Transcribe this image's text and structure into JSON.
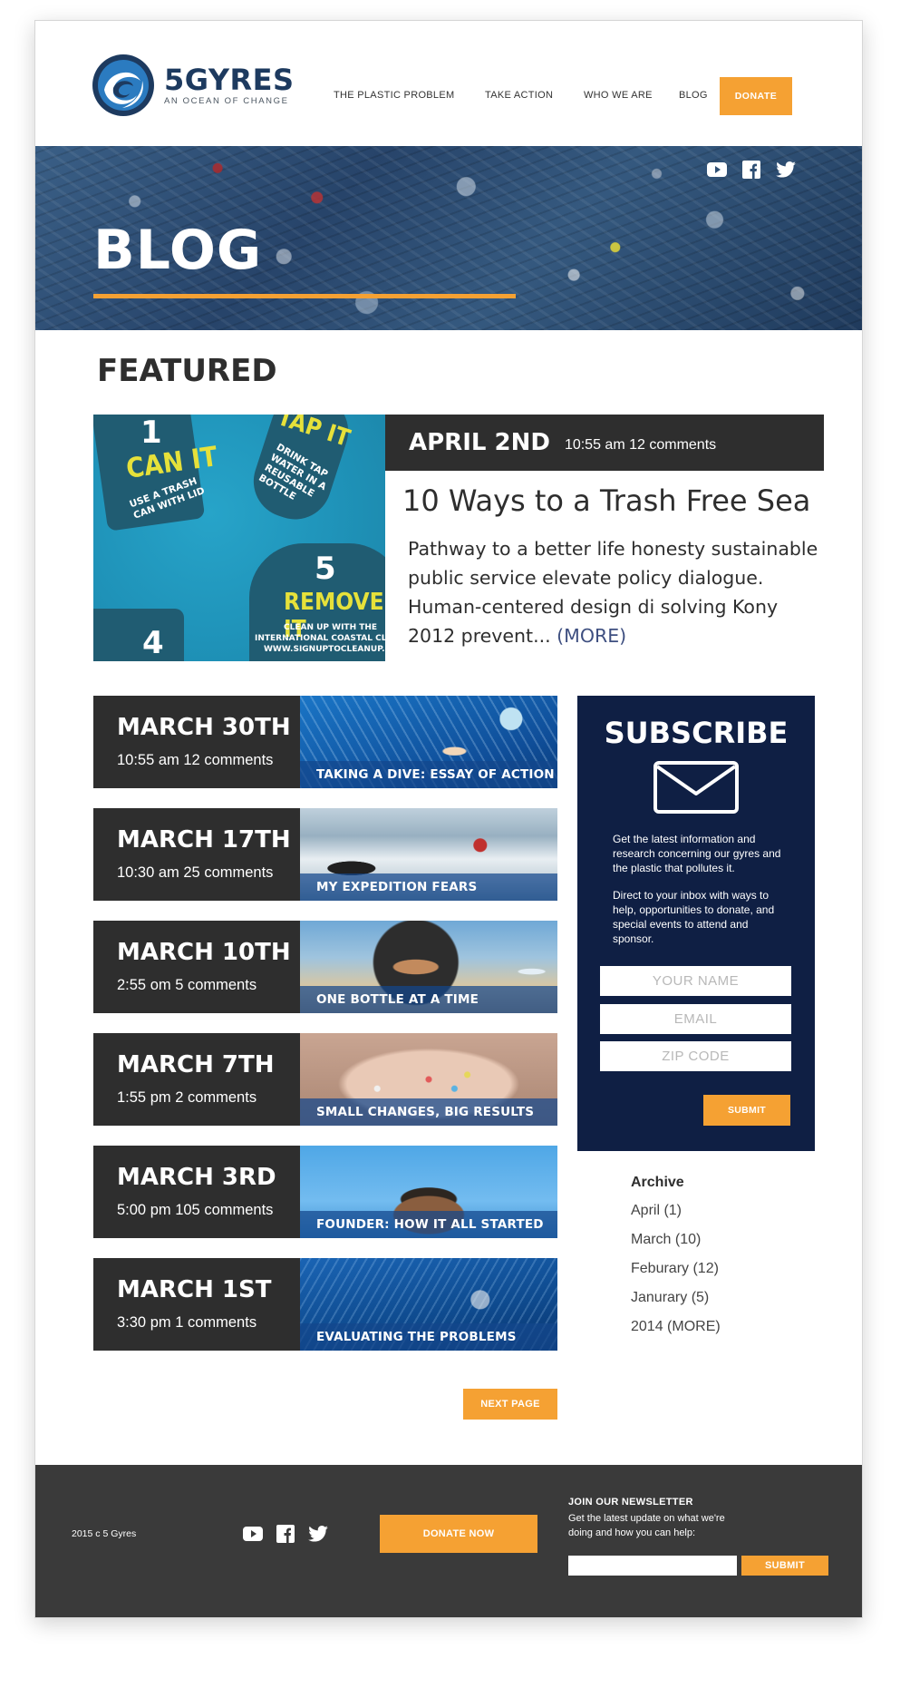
{
  "brand": {
    "name": "5GYRES",
    "tagline": "AN OCEAN OF CHANGE"
  },
  "nav": {
    "items": [
      {
        "label": "THE PLASTIC PROBLEM"
      },
      {
        "label": "TAKE ACTION"
      },
      {
        "label": "WHO WE ARE"
      },
      {
        "label": "BLOG"
      }
    ],
    "donate_label": "DONATE"
  },
  "hero": {
    "title": "BLOG",
    "social_icons": [
      "youtube-icon",
      "facebook-icon",
      "twitter-icon"
    ]
  },
  "featured": {
    "section_title": "FEATURED",
    "date": "APRIL 2ND",
    "meta": "10:55 am  12 comments",
    "title": "10 Ways to a Trash Free Sea",
    "excerpt": "Pathway to a better life honesty sustainable public service elevate policy dialogue. Human-centered design di solving Kony 2012 prevent...",
    "more_label": "(MORE)",
    "image_text": {
      "num1": "1",
      "can_it": "CAN IT",
      "can_it_sub": "USE A TRASH CAN WITH LID",
      "tap_it": "TAP IT",
      "tap_it_sub": "DRINK TAP WATER IN A REUSABLE BOTTLE",
      "num5": "5",
      "remove_it": "REMOVE IT",
      "remove_sub1": "CLEAN UP WITH THE",
      "remove_sub2": "INTERNATIONAL COASTAL CLEAN",
      "remove_sub3": "WWW.SIGNUPTOCLEANUP.ORG",
      "num4": "4"
    }
  },
  "posts": [
    {
      "date": "MARCH 30TH",
      "meta": "10:55 am  12 comments",
      "caption": "TAKING A DIVE: ESSAY OF ACTION"
    },
    {
      "date": "MARCH 17TH",
      "meta": "10:30 am  25 comments",
      "caption": "MY EXPEDITION FEARS"
    },
    {
      "date": "MARCH 10TH",
      "meta": "2:55 om  5 comments",
      "caption": "ONE BOTTLE AT A TIME"
    },
    {
      "date": "MARCH 7TH",
      "meta": "1:55 pm  2 comments",
      "caption": "SMALL CHANGES, BIG RESULTS"
    },
    {
      "date": "MARCH 3RD",
      "meta": "5:00 pm  105 comments",
      "caption": "FOUNDER: HOW IT ALL STARTED"
    },
    {
      "date": "MARCH 1ST",
      "meta": "3:30 pm  1 comments",
      "caption": "EVALUATING THE PROBLEMS"
    }
  ],
  "next_page_label": "NEXT PAGE",
  "subscribe": {
    "title": "SUBSCRIBE",
    "text1": "Get the latest information and research concerning our gyres and the plastic that pollutes it.",
    "text2": "Direct to your inbox with ways to help, opportunities to donate, and special events to attend and sponsor.",
    "name_placeholder": "YOUR NAME",
    "email_placeholder": "EMAIL",
    "zip_placeholder": "ZIP CODE",
    "submit_label": "SUBMIT"
  },
  "archive": {
    "title": "Archive",
    "items": [
      "April (1)",
      "March (10)",
      "Feburary (12)",
      "Janurary (5)",
      "2014 (MORE)"
    ]
  },
  "footer": {
    "copyright": "2015 c 5 Gyres",
    "donate_now_label": "DONATE NOW",
    "newsletter_title": "JOIN OUR NEWSLETTER",
    "newsletter_text": "Get the latest update on what we're doing and how you can help:",
    "submit_label": "SUBMIT"
  },
  "colors": {
    "accent": "#f5a133",
    "dark": "#2e2e2e",
    "navy": "#0f1f44",
    "brand_blue": "#1d3a5f",
    "footer": "#3a3a3a"
  }
}
